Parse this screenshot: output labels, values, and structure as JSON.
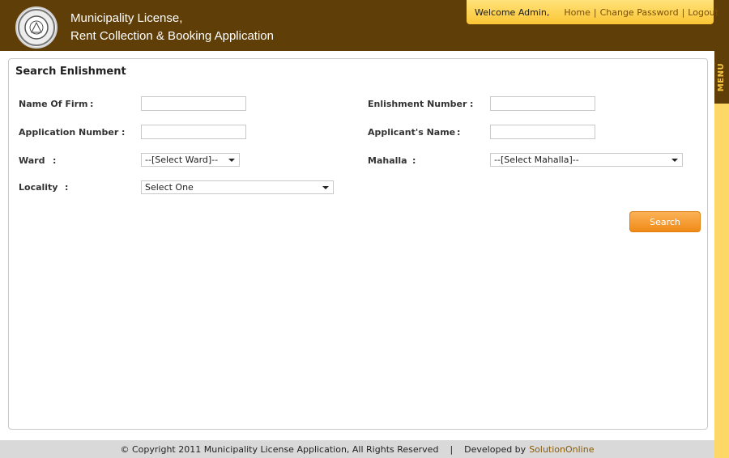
{
  "header": {
    "title_line1": "Municipality License,",
    "title_line2": "Rent Collection & Booking Application",
    "logo_icon": "municipality-seal-icon"
  },
  "topbar": {
    "welcome": "Welcome Admin,",
    "links": [
      "Home",
      "Change Password",
      "Logout"
    ],
    "separator": "|"
  },
  "menu": {
    "label": "MENU"
  },
  "form": {
    "title": "Search Enlishment",
    "fields": {
      "name_of_firm": {
        "label": "Name Of Firm",
        "value": ""
      },
      "enlishment_number": {
        "label": "Enlishment Number",
        "value": ""
      },
      "application_number": {
        "label": "Application Number",
        "value": ""
      },
      "applicants_name": {
        "label": "Applicant's Name",
        "value": ""
      },
      "ward": {
        "label": "Ward",
        "selected": "--[Select Ward]--"
      },
      "mahalla": {
        "label": "Mahalla",
        "selected": "--[Select Mahalla]--"
      },
      "locality": {
        "label": "Locality",
        "selected": "Select One"
      }
    },
    "colon": ":",
    "search_label": "Search"
  },
  "footer": {
    "copyright": "© Copyright 2011 Municipality License Application, All Rights Reserved",
    "divider": "|",
    "developed_by": "Developed by",
    "developer": "SolutionOnline"
  },
  "colors": {
    "header_bg": "#603e08",
    "topbar_bg": "#fbc534",
    "menu_strip": "#fdd867",
    "button": "#f08a17"
  }
}
